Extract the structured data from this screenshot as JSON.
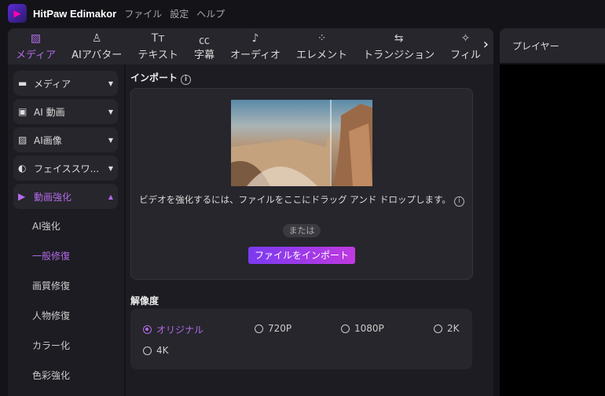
{
  "titlebar": {
    "app_name": "HitPaw Edimakor",
    "menus": [
      "ファイル",
      "設定",
      "ヘルプ"
    ]
  },
  "toolbar": {
    "tabs": [
      {
        "label": "メディア",
        "icon": "media-icon",
        "glyph": "▧",
        "active": true
      },
      {
        "label": "AIアバター",
        "icon": "avatar-icon",
        "glyph": "♙"
      },
      {
        "label": "テキスト",
        "icon": "text-icon",
        "glyph": "Tт"
      },
      {
        "label": "字幕",
        "icon": "subtitle-icon",
        "glyph": "㏄"
      },
      {
        "label": "オーディオ",
        "icon": "audio-icon",
        "glyph": "♪"
      },
      {
        "label": "エレメント",
        "icon": "element-icon",
        "glyph": "⁘"
      },
      {
        "label": "トランジション",
        "icon": "transition-icon",
        "glyph": "⇆"
      },
      {
        "label": "フィル",
        "icon": "filter-icon",
        "glyph": "✧"
      }
    ],
    "next": "›"
  },
  "player": {
    "title": "プレイヤー"
  },
  "sidebar": {
    "categories": [
      {
        "label": "メディア",
        "icon": "folder-icon",
        "glyph": "▬"
      },
      {
        "label": "AI 動画",
        "icon": "ai-video-icon",
        "glyph": "▣"
      },
      {
        "label": "AI画像",
        "icon": "ai-image-icon",
        "glyph": "▨"
      },
      {
        "label": "フェイススワ...",
        "icon": "face-swap-icon",
        "glyph": "◐"
      },
      {
        "label": "動画強化",
        "icon": "video-enhance-icon",
        "glyph": "▶",
        "active": true
      }
    ],
    "subitems": [
      "AI強化",
      "一般修復",
      "画質修復",
      "人物修復",
      "カラー化",
      "色彩強化"
    ],
    "active_sub": "一般修復"
  },
  "main": {
    "import_title": "インポート",
    "hint": "ビデオを強化するには、ファイルをここにドラッグ アンド ドロップします。",
    "or": "または",
    "import_button": "ファイルをインポート",
    "resolution_title": "解像度",
    "resolutions": [
      "オリジナル",
      "720P",
      "1080P",
      "2K",
      "4K"
    ],
    "selected_resolution": "オリジナル"
  },
  "colors": {
    "accent": "#b36ae8",
    "button_start": "#7a3af0",
    "button_end": "#c03ae0"
  }
}
